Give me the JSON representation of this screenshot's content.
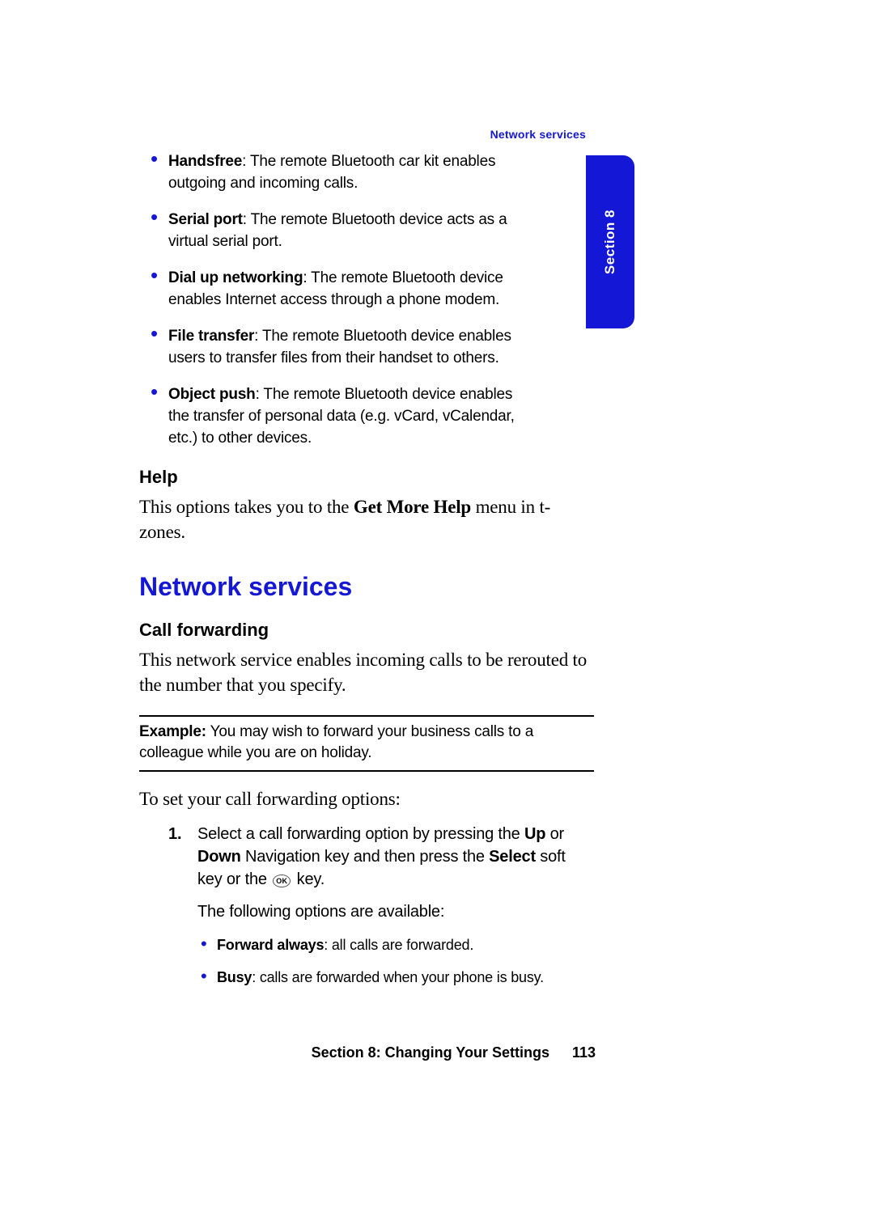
{
  "header": {
    "running_title": "Network services",
    "section_tab": "Section 8"
  },
  "bluetooth_profiles": [
    {
      "name": "Handsfree",
      "desc": ": The remote Bluetooth car kit enables outgoing and incoming calls."
    },
    {
      "name": "Serial port",
      "desc": ": The remote Bluetooth device acts as a virtual serial port."
    },
    {
      "name": "Dial up networking",
      "desc": ": The remote Bluetooth device enables Internet access through a phone modem."
    },
    {
      "name": "File transfer",
      "desc": ": The remote Bluetooth device enables users to transfer files from their handset to others."
    },
    {
      "name": "Object push",
      "desc": ": The remote Bluetooth device enables the transfer of personal data (e.g. vCard, vCalendar, etc.) to other devices."
    }
  ],
  "help": {
    "heading": "Help",
    "text_before": "This options takes you to the ",
    "bold": "Get More Help",
    "text_after": " menu in t-zones."
  },
  "network": {
    "heading": "Network services",
    "call_forwarding_heading": "Call forwarding",
    "call_forwarding_body": "This network service enables incoming calls to be rerouted to the number that you specify.",
    "example_label": "Example:",
    "example_text": " You may wish to forward your business calls to a colleague while you are on holiday.",
    "instructions_intro": "To set your call forwarding options:",
    "step1": {
      "pre": "Select a call forwarding option by pressing the ",
      "up": "Up",
      "mid": " or ",
      "down": "Down",
      "mid2": " Navigation key and then press the ",
      "select": "Select",
      "post": " soft key or the ",
      "key_label": "OK",
      "post2": " key."
    },
    "step_follow": "The following options are available:",
    "options": [
      {
        "name": "Forward always",
        "desc": ": all calls are forwarded."
      },
      {
        "name": "Busy",
        "desc": ": calls are forwarded when your phone is busy."
      }
    ]
  },
  "footer": {
    "text": "Section 8: Changing Your Settings",
    "page": "113"
  }
}
